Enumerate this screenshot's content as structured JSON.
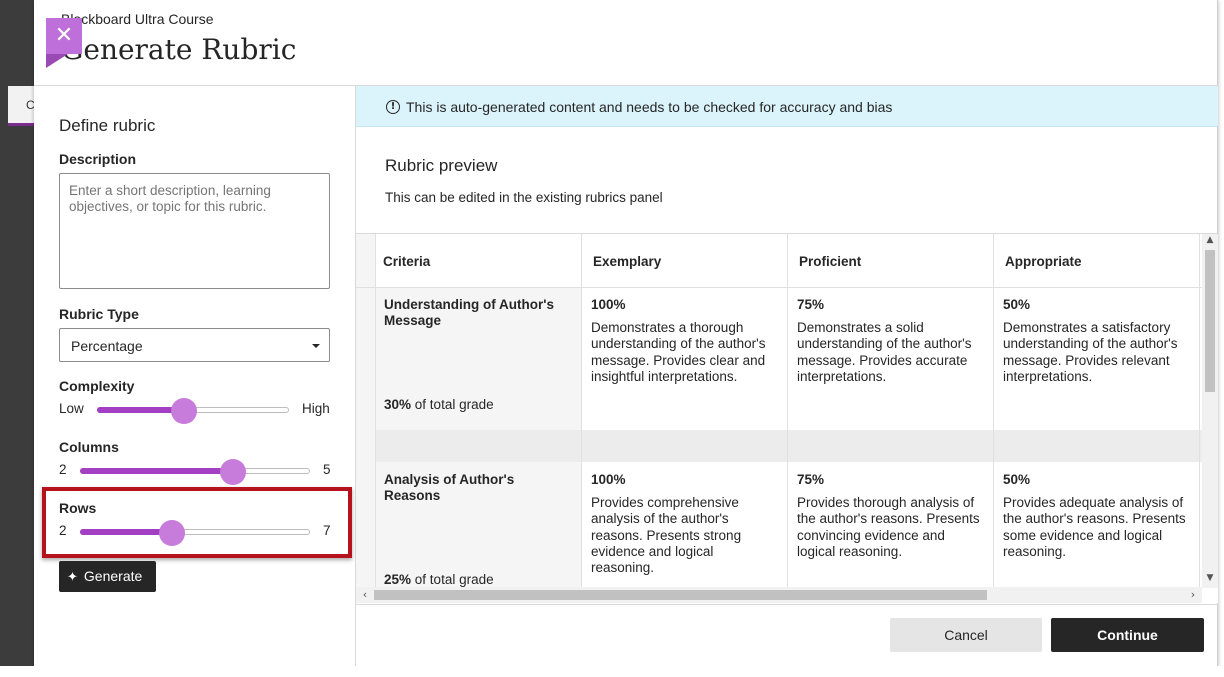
{
  "background": {
    "tab_letter": "C"
  },
  "header": {
    "course_name": "Blackboard Ultra Course",
    "title": "Generate Rubric",
    "close_symbol": "✕"
  },
  "define": {
    "title": "Define rubric",
    "description_label": "Description",
    "description_placeholder": "Enter a short description, learning objectives, or topic for this rubric.",
    "rubric_type_label": "Rubric Type",
    "rubric_type_value": "Percentage",
    "complexity": {
      "label": "Complexity",
      "min": "Low",
      "max": "High",
      "level": 0.45
    },
    "columns": {
      "label": "Columns",
      "min": "2",
      "max": "5",
      "value": 4
    },
    "rows": {
      "label": "Rows",
      "min": "2",
      "max": "7",
      "value": 4
    },
    "generate_label": "Generate"
  },
  "notice": {
    "text": "This is auto-generated content and needs to be checked for accuracy and bias"
  },
  "preview": {
    "title": "Rubric preview",
    "subtitle": "This can be edited in the existing rubrics panel",
    "columns": [
      "Criteria",
      "Exemplary",
      "Proficient",
      "Appropriate"
    ],
    "rows": [
      {
        "criterion": "Understanding of Author's Message",
        "weight": "30%",
        "weight_suffix": "of total grade",
        "cells": [
          {
            "percent": "100%",
            "text": "Demonstrates a thorough understanding of the author's message. Provides clear and insightful interpretations."
          },
          {
            "percent": "75%",
            "text": "Demonstrates a solid understanding of the author's message. Provides accurate interpretations."
          },
          {
            "percent": "50%",
            "text": "Demonstrates a satisfactory understanding of the author's message. Provides relevant interpretations."
          }
        ]
      },
      {
        "criterion": "Analysis of Author's Reasons",
        "weight": "25%",
        "weight_suffix": "of total grade",
        "cells": [
          {
            "percent": "100%",
            "text": "Provides comprehensive analysis of the author's reasons. Presents strong evidence and logical reasoning."
          },
          {
            "percent": "75%",
            "text": "Provides thorough analysis of the author's reasons. Presents convincing evidence and logical reasoning."
          },
          {
            "percent": "50%",
            "text": "Provides adequate analysis of the author's reasons. Presents some evidence and logical reasoning."
          }
        ]
      }
    ]
  },
  "footer": {
    "cancel_label": "Cancel",
    "continue_label": "Continue"
  },
  "colors": {
    "accent": "#a23fc2",
    "thumb": "#c77bdb",
    "highlight": "#b5121b",
    "notice_bg": "#dbf3fb"
  }
}
